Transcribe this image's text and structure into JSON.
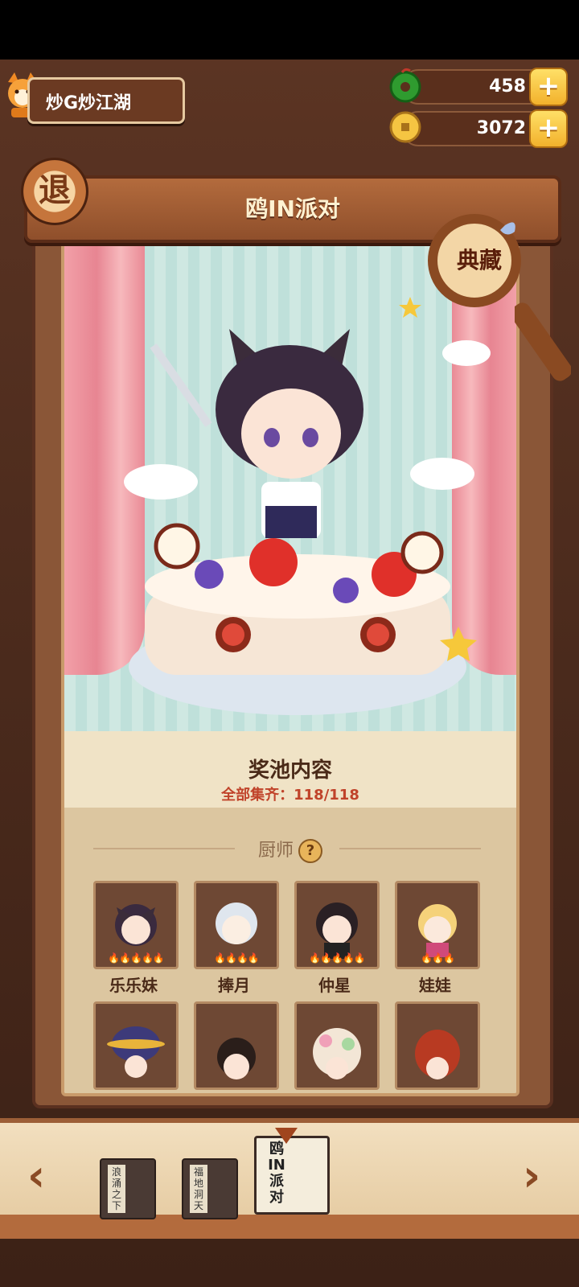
{
  "player": {
    "name": "炒G炒江湖"
  },
  "currency": {
    "jade": {
      "value": "458",
      "icon": "jade-coin-icon"
    },
    "coins": {
      "value": "3072",
      "icon": "gold-coin-icon"
    },
    "plus": "+"
  },
  "header": {
    "back_label": "退",
    "title": "鸥IN派对",
    "collection_label": "典藏"
  },
  "pool": {
    "title": "奖池内容",
    "progress_label": "全部集齐：118/118"
  },
  "section": {
    "label": "厨师",
    "help": "?"
  },
  "chefs": [
    {
      "name": "乐乐妹",
      "stars": "🔥🔥🔥🔥🔥"
    },
    {
      "name": "捧月",
      "stars": "🔥🔥🔥🔥"
    },
    {
      "name": "仲星",
      "stars": "🔥🔥🔥🔥🔥"
    },
    {
      "name": "娃娃",
      "stars": "🔥🔥🔥"
    },
    {
      "name": "",
      "stars": ""
    },
    {
      "name": "",
      "stars": ""
    },
    {
      "name": "",
      "stars": ""
    },
    {
      "name": "",
      "stars": ""
    }
  ],
  "nav": {
    "prev": "‹",
    "next": "›",
    "books": [
      {
        "label": "浪涌之下"
      },
      {
        "label": "福地洞天"
      }
    ],
    "active_book": {
      "label": "鸥IN派对"
    }
  }
}
